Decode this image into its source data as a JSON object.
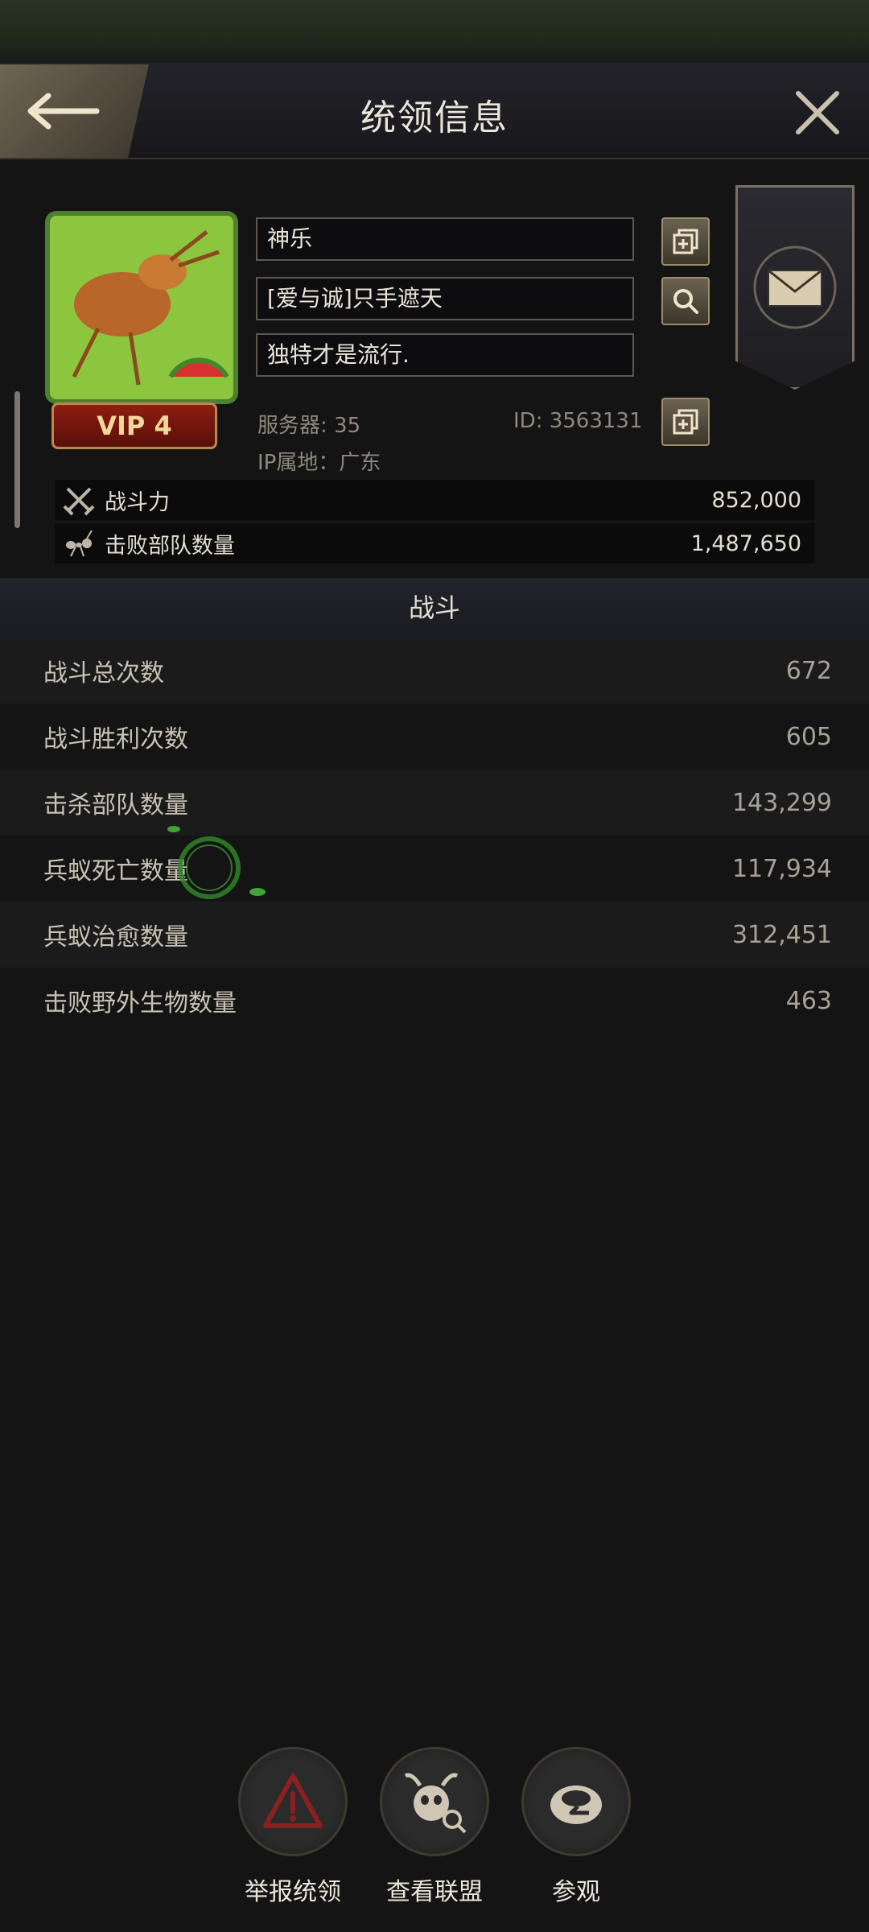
{
  "header": {
    "title": "统领信息"
  },
  "profile": {
    "vip": "VIP 4",
    "name": "神乐",
    "alliance": "[爱与诚]只手遮天",
    "signature": "独特才是流行.",
    "server": "服务器: 35",
    "id": "ID: 3563131",
    "ip": "IP属地：广东"
  },
  "summary": [
    {
      "label": "战斗力",
      "value": "852,000",
      "icon": "crossed-swords-icon"
    },
    {
      "label": "击败部队数量",
      "value": "1,487,650",
      "icon": "ant-icon"
    }
  ],
  "section": {
    "title": "战斗"
  },
  "battle_stats": [
    {
      "label": "战斗总次数",
      "value": "672"
    },
    {
      "label": "战斗胜利次数",
      "value": "605"
    },
    {
      "label": "击杀部队数量",
      "value": "143,299"
    },
    {
      "label": "兵蚁死亡数量",
      "value": "117,934"
    },
    {
      "label": "兵蚁治愈数量",
      "value": "312,451"
    },
    {
      "label": "击败野外生物数量",
      "value": "463"
    }
  ],
  "actions": [
    {
      "label": "举报统领",
      "icon": "report-warning-icon"
    },
    {
      "label": "查看联盟",
      "icon": "alliance-view-icon"
    },
    {
      "label": "参观",
      "icon": "visit-icon"
    }
  ],
  "colors": {
    "accent_gold": "#b8894a",
    "vip_red": "#8e1d12",
    "avatar_green": "#7fbd3a"
  }
}
